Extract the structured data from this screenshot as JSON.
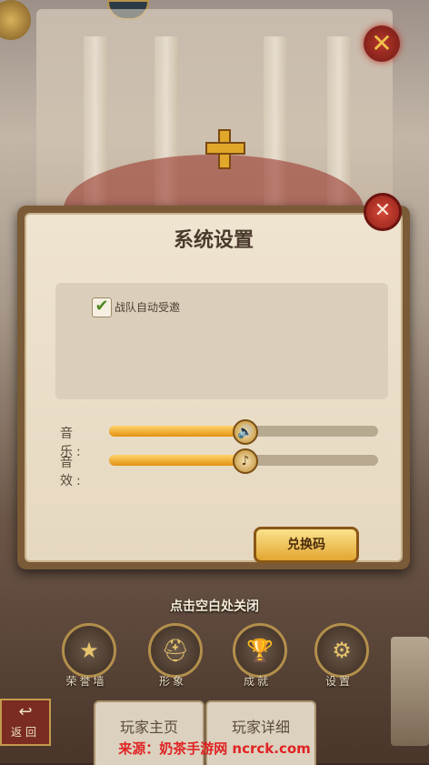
{
  "dialog": {
    "title": "系统设置",
    "close_icon": "close-icon",
    "option_auto_accept": {
      "label": "战队自动受邀",
      "checked": true
    },
    "music": {
      "label": "音 乐:",
      "level_percent": 50,
      "icon": "speaker-icon"
    },
    "sfx": {
      "label": "音 效:",
      "level_percent": 50,
      "icon": "music-note-icon"
    },
    "redeem_button": "兑换码"
  },
  "tap_to_close": "点击空白处关闭",
  "menu": [
    {
      "label": "荣誉墙",
      "icon": "star-icon"
    },
    {
      "label": "形象",
      "icon": "helmet-icon"
    },
    {
      "label": "成就",
      "icon": "trophy-icon"
    },
    {
      "label": "设置",
      "icon": "gear-icon"
    }
  ],
  "back_button": "返回",
  "tabs": [
    "玩家主页",
    "玩家详细"
  ],
  "watermark": "来源：奶茶手游网 ncrck.com",
  "colors": {
    "accent": "#e39211",
    "close_red": "#c0392b",
    "watermark": "#e02323"
  }
}
